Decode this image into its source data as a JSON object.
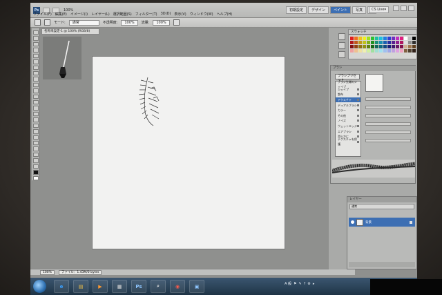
{
  "app": {
    "logo": "Ps",
    "zoom_menu": "100%",
    "menu": [
      "ファイル(F)",
      "編集(E)",
      "イメージ(I)",
      "レイヤー(L)",
      "選択範囲(S)",
      "フィルター(T)",
      "3D(D)",
      "表示(V)",
      "ウィンドウ(W)",
      "ヘルプ(H)"
    ],
    "workspaces": [
      {
        "label": "初期設定",
        "active": false
      },
      {
        "label": "デザイン",
        "active": false
      },
      {
        "label": "ペイント",
        "active": true
      },
      {
        "label": "写真",
        "active": false
      }
    ],
    "workspace_more": "»",
    "cslive": "CS Live▾"
  },
  "options_bar": {
    "mode_label": "モード:",
    "mode_value": "通常",
    "opacity_label": "不透明度:",
    "opacity_value": "100%",
    "flow_label": "流量:",
    "flow_value": "100%"
  },
  "document": {
    "tab_title": "名称未設定-1 @ 100% (RGB/8)"
  },
  "status_bar": {
    "zoom": "100%",
    "file_info": "ファイル：1.43M/0 bytes"
  },
  "panels": {
    "swatches_title": "スウォッチ",
    "swatch_colors": [
      "#e02020",
      "#f07020",
      "#f0c020",
      "#f0f020",
      "#a0e020",
      "#30c030",
      "#20c0a0",
      "#20c0e0",
      "#2080e0",
      "#3040d0",
      "#7030c0",
      "#c030c0",
      "#e02080",
      "#ffffff",
      "#c0c0c0",
      "#000000",
      "#b01818",
      "#c05818",
      "#c09818",
      "#c0c018",
      "#80b018",
      "#209020",
      "#189078",
      "#1890b0",
      "#1860b0",
      "#2830a0",
      "#582090",
      "#902090",
      "#b01860",
      "#e0e0e0",
      "#909090",
      "#303030",
      "#801010",
      "#904010",
      "#907010",
      "#909010",
      "#608010",
      "#186818",
      "#106858",
      "#106880",
      "#104880",
      "#182078",
      "#401870",
      "#681868",
      "#801048",
      "#d0b090",
      "#a07850",
      "#604020",
      "#f0a0a0",
      "#f0c090",
      "#f0e0a0",
      "#f0f0b0",
      "#d0f0a0",
      "#a0e0a0",
      "#a0e0d0",
      "#a0e0f0",
      "#a0c0f0",
      "#a0a8e8",
      "#c0a0e0",
      "#e0a0e0",
      "#f0a0c0",
      "#806040",
      "#504030",
      "#302018"
    ],
    "brush": {
      "tab_title": "ブラシ",
      "preset_button": "ブラシプリセット",
      "options": [
        {
          "label": "ブラシ先端のシェイプ",
          "selected": false,
          "lock": false
        },
        {
          "label": "シェイプ",
          "selected": false,
          "lock": true
        },
        {
          "label": "散布",
          "selected": false,
          "lock": true
        },
        {
          "label": "テクスチャ",
          "selected": true,
          "lock": true
        },
        {
          "label": "デュアルブラシ",
          "selected": false,
          "lock": true
        },
        {
          "label": "カラー",
          "selected": false,
          "lock": true
        },
        {
          "label": "その他",
          "selected": false,
          "lock": true
        },
        {
          "label": "ノイズ",
          "selected": false,
          "lock": true
        },
        {
          "label": "ウェットエッジ",
          "selected": false,
          "lock": true
        },
        {
          "label": "エアブラシ",
          "selected": false,
          "lock": true
        },
        {
          "label": "滑らかに",
          "selected": false,
          "lock": true
        },
        {
          "label": "テクスチャを保護",
          "selected": false,
          "lock": true
        }
      ]
    },
    "layers": {
      "tab_title": "レイヤー",
      "blend_mode": "通常",
      "opacity_label": "不透明度:",
      "opacity_value": "100%",
      "lock_label": "ロック:",
      "fill_label": "塗り:",
      "fill_value": "100%",
      "items": [
        {
          "name": "背景"
        }
      ]
    }
  },
  "taskbar": {
    "buttons": [
      {
        "name": "ie",
        "glyph": "e",
        "color": "#3aa0ff"
      },
      {
        "name": "explorer",
        "glyph": "▤",
        "color": "#f3c34a"
      },
      {
        "name": "media-player",
        "glyph": "▶",
        "color": "#ff9a30"
      },
      {
        "name": "film",
        "glyph": "▦",
        "color": "#dddddd"
      },
      {
        "name": "photoshop",
        "glyph": "Ps",
        "color": "#8ec6ff"
      },
      {
        "name": "search",
        "glyph": "⌕",
        "color": "#dddddd"
      },
      {
        "name": "app-red",
        "glyph": "◉",
        "color": "#ff5a4a"
      },
      {
        "name": "monitor",
        "glyph": "▣",
        "color": "#8ec6ff"
      }
    ],
    "tray": {
      "ime": "A 般",
      "icons": [
        "⚑",
        "✎",
        "?",
        "⚙",
        "▸"
      ]
    }
  }
}
